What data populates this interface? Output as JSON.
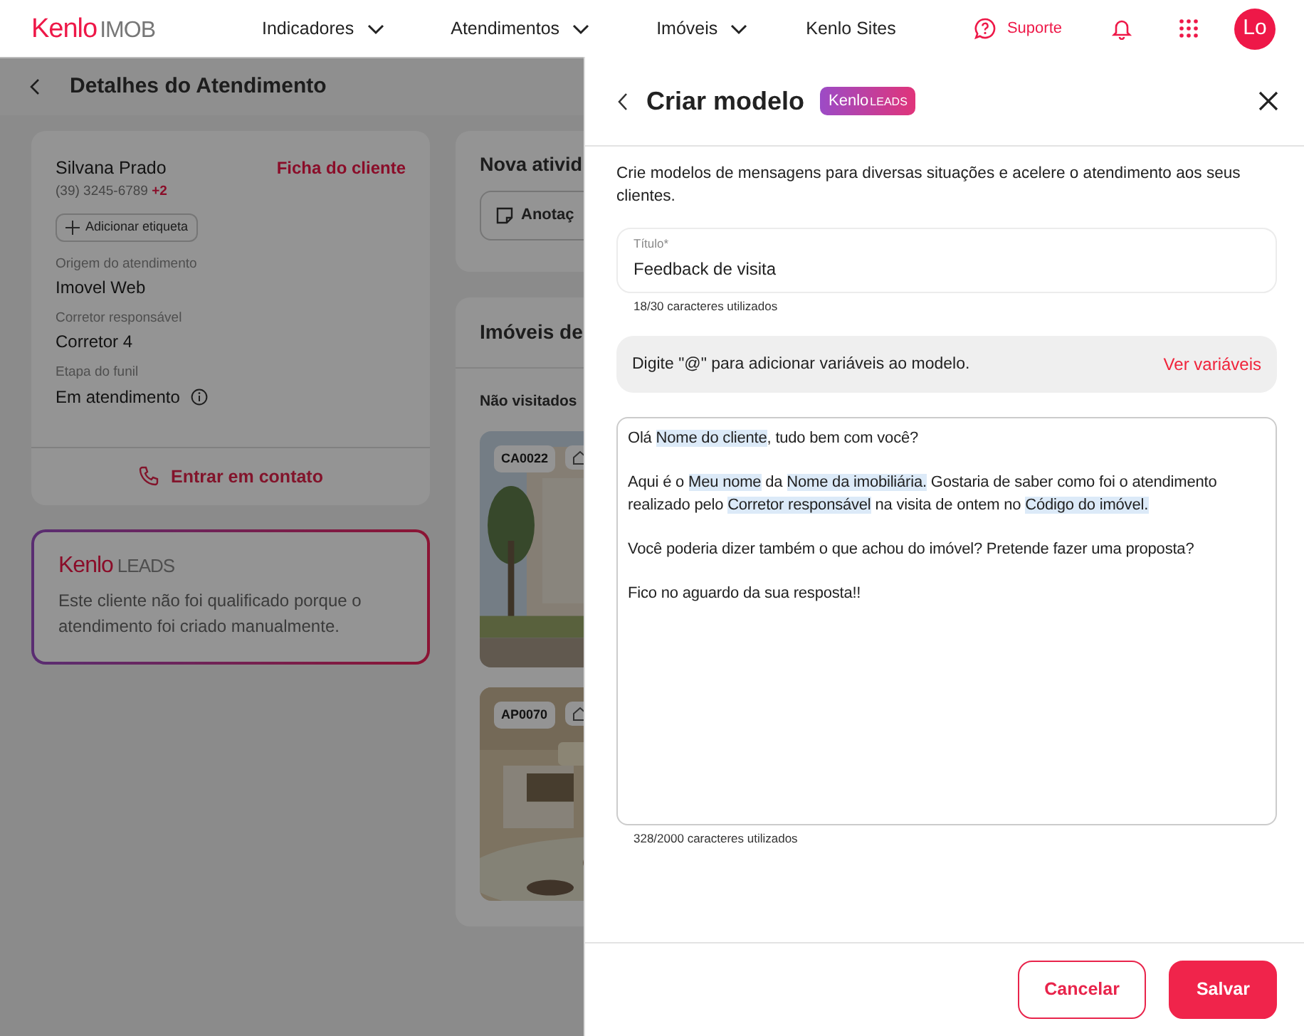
{
  "navbar": {
    "logo": {
      "brand": "Kenlo",
      "product": "IMOB"
    },
    "menu": [
      {
        "label": "Indicadores",
        "dropdown": true
      },
      {
        "label": "Atendimentos",
        "dropdown": true
      },
      {
        "label": "Imóveis",
        "dropdown": true
      },
      {
        "label": "Kenlo Sites",
        "dropdown": false
      }
    ],
    "support": "Suporte",
    "avatar": "Lo"
  },
  "page": {
    "title": "Detalhes do Atendimento",
    "client_card": {
      "name": "Silvana Prado",
      "phone": "(39) 3245-6789",
      "extra_phones": "+2",
      "link": "Ficha do cliente",
      "tag_button": "Adicionar etiqueta",
      "fields": [
        {
          "label": "Origem do atendimento",
          "value": "Imovel Web",
          "info": false
        },
        {
          "label": "Corretor responsável",
          "value": "Corretor 4",
          "info": false
        },
        {
          "label": "Etapa do funil",
          "value": "Em atendimento",
          "info": true
        }
      ],
      "contact_button": "Entrar em contato"
    },
    "leads_card": {
      "brand": "Kenlo",
      "product": "LEADS",
      "text": "Este cliente não foi qualificado porque o atendimento foi criado manualmente."
    },
    "activity_card": {
      "title": "Nova ativid",
      "button": "Anotaç"
    },
    "properties_card": {
      "title": "Imóveis de",
      "section": "Não visitados",
      "properties": [
        {
          "code": "CA0022",
          "kind": "house"
        },
        {
          "code": "AP0070",
          "kind": "interior"
        }
      ]
    }
  },
  "drawer": {
    "title": "Criar modelo",
    "badge": {
      "brand": "Kenlo",
      "product": "LEADS"
    },
    "description": "Crie modelos de mensagens para diversas situações e acelere o atendimento aos seus clientes.",
    "title_field": {
      "label": "Título*",
      "value": "Feedback de visita",
      "counter": "18/30 caracteres utilizados"
    },
    "hint": {
      "text": "Digite \"@\" para adicionar variáveis ao modelo.",
      "link": "Ver variáveis"
    },
    "message": {
      "paragraphs": [
        [
          {
            "text": "Olá ",
            "variable": false
          },
          {
            "text": "Nome do cliente",
            "variable": true
          },
          {
            "text": ", tudo bem com você?",
            "variable": false
          }
        ],
        [
          {
            "text": "Aqui é o ",
            "variable": false
          },
          {
            "text": "Meu nome",
            "variable": true
          },
          {
            "text": " da ",
            "variable": false
          },
          {
            "text": "Nome da imobiliária.",
            "variable": true
          },
          {
            "text": " Gostaria de saber como foi o atendimento realizado pelo ",
            "variable": false
          },
          {
            "text": "Corretor responsável",
            "variable": true
          },
          {
            "text": " na visita de ontem no ",
            "variable": false
          },
          {
            "text": "Código do imóvel.",
            "variable": true
          }
        ],
        [
          {
            "text": "Você poderia dizer também o que achou do imóvel? Pretende fazer uma proposta?",
            "variable": false
          }
        ],
        [
          {
            "text": "Fico no aguardo da sua resposta!!",
            "variable": false
          }
        ]
      ],
      "counter": "328/2000 caracteres utilizados"
    },
    "buttons": [
      {
        "label": "Cancelar",
        "kind": "outline"
      },
      {
        "label": "Salvar",
        "kind": "primary"
      }
    ]
  }
}
